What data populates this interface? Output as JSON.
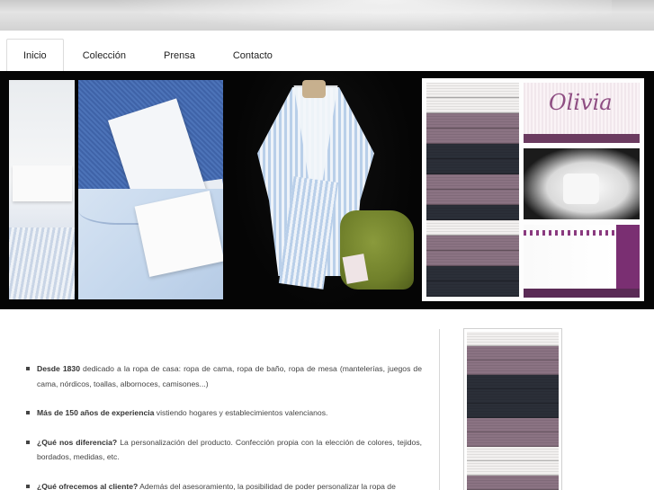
{
  "nav": {
    "items": [
      {
        "label": "Inicio",
        "active": true
      },
      {
        "label": "Colección",
        "active": false
      },
      {
        "label": "Prensa",
        "active": false
      },
      {
        "label": "Contacto",
        "active": false
      }
    ]
  },
  "hero": {
    "olivia_embroidery": "Olivia"
  },
  "content": {
    "bullets": [
      {
        "strong": "Desde 1830",
        "text": " dedicado a la ropa de casa: ropa de cama, ropa de baño, ropa de mesa (mantelerías, juegos de cama, nórdicos, toallas, albornoces, camisones...)"
      },
      {
        "strong": "Más de 150 años de experiencia",
        "text": " vistiendo hogares y establecimientos valencianos."
      },
      {
        "strong": "¿Qué nos diferencia?",
        "text": "  La personalización del producto. Confección propia con la elección de colores, tejidos, bordados, medidas, etc."
      },
      {
        "strong": "¿Qué ofrecemos al cliente?",
        "text": " Además del asesoramiento, la posibilidad de poder personalizar la ropa de"
      }
    ]
  },
  "colors": {
    "hero_background": "#050505",
    "towel_lilac": "#8b7383",
    "towel_dark": "#2b2f38",
    "towel_white": "#f2f0ef",
    "accent_purple": "#7a2f72"
  }
}
